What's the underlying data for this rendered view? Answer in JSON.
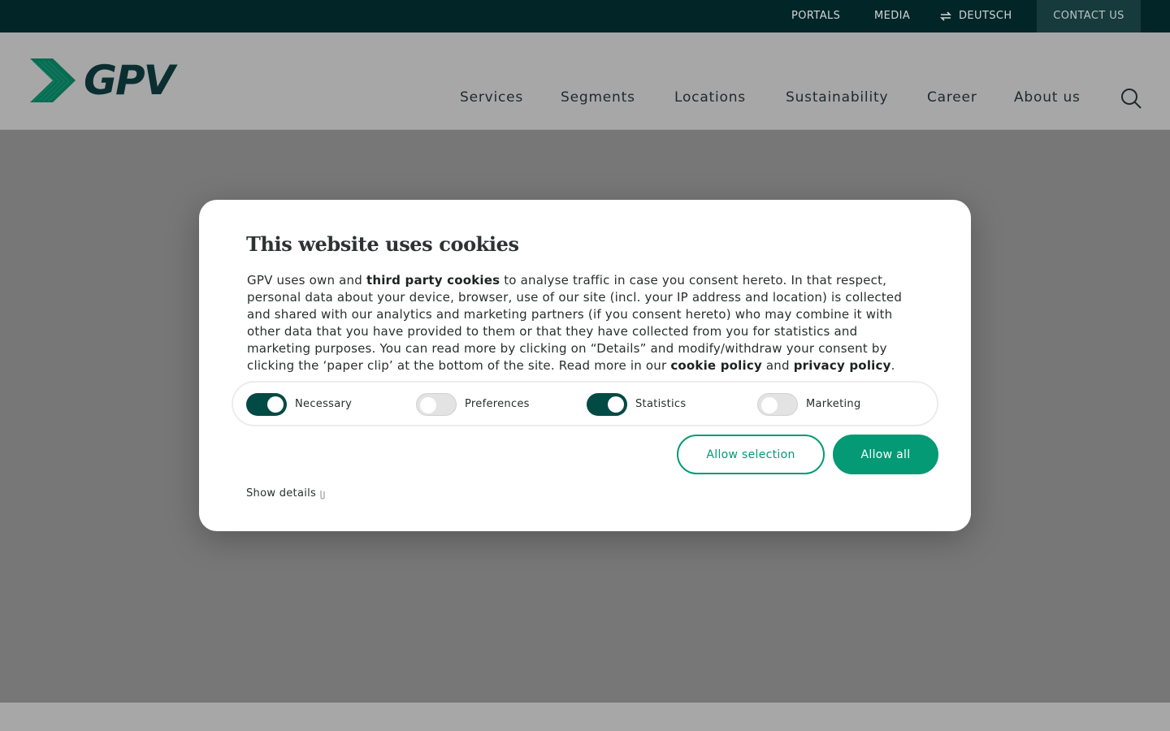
{
  "topbar": {
    "portals": "PORTALS",
    "media": "MEDIA",
    "language": "DEUTSCH",
    "contact": "CONTACT US"
  },
  "header": {
    "logo_text": "GPV",
    "nav": [
      {
        "label": "Services"
      },
      {
        "label": "Segments"
      },
      {
        "label": "Locations"
      },
      {
        "label": "Sustainability"
      },
      {
        "label": "Career"
      },
      {
        "label": "About us"
      }
    ]
  },
  "cookie_dialog": {
    "title": "This website uses cookies",
    "body": {
      "t1": "GPV uses own and ",
      "link1": "third party cookies",
      "t2": " to analyse traffic in case you consent hereto. In that respect, personal data about your device, browser, use of our site (incl. your IP address and location) is collected and shared with our analytics and marketing partners (if you consent hereto) who may combine it with other data that you have provided to them or that they have collected from you for statistics and marketing purposes. You can read more by clicking on “Details” and modify/withdraw your consent by clicking the ‘paper clip’ at the bottom of the site. Read more in our ",
      "link2": "cookie policy",
      "t3": " and ",
      "link3": "privacy policy",
      "t4": "."
    },
    "toggles": [
      {
        "label": "Necessary",
        "on": true
      },
      {
        "label": "Preferences",
        "on": false
      },
      {
        "label": "Statistics",
        "on": true
      },
      {
        "label": "Marketing",
        "on": false
      }
    ],
    "allow_selection": "Allow selection",
    "allow_all": "Allow all",
    "show_details": "Show details"
  },
  "colors": {
    "topbar_bg": "#022628",
    "accent_green": "#049a76",
    "toggle_on": "#024a44",
    "logo_dark": "#0b2f31"
  }
}
